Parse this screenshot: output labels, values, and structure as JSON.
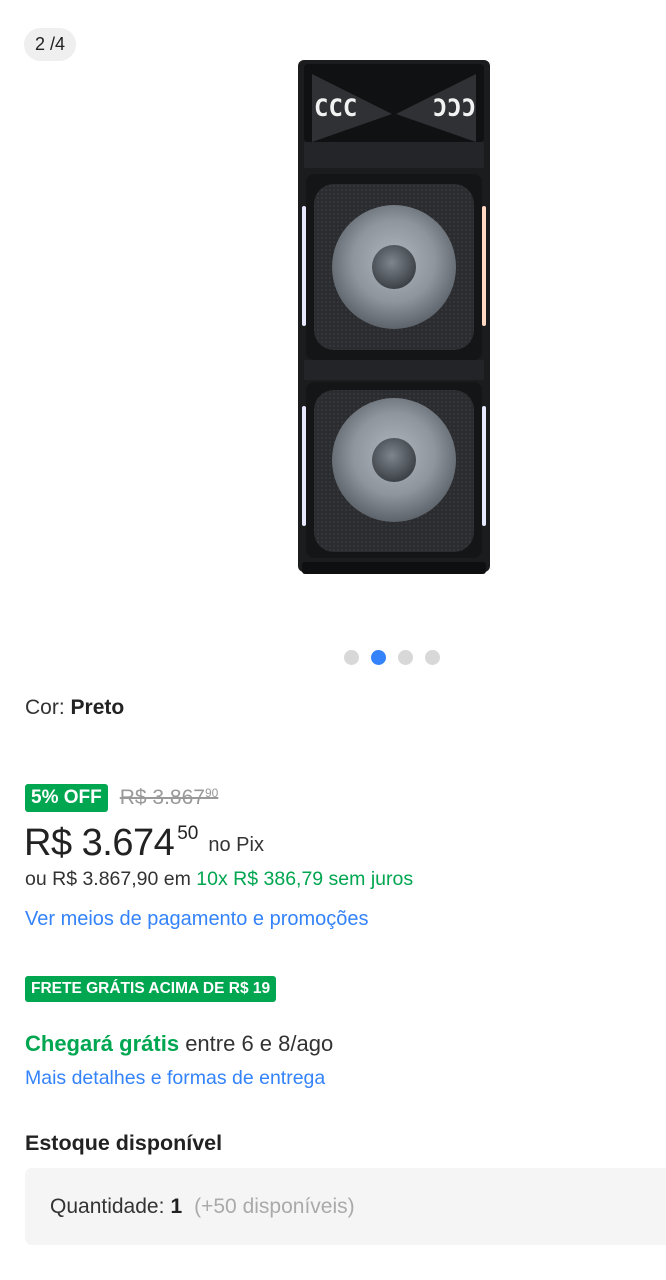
{
  "gallery": {
    "counter": "2 /4",
    "total_images": 4,
    "active_index": 1,
    "brand_mark_text": "CCC ƆƆƆ"
  },
  "product": {
    "color_label": "Cor:",
    "color_value": "Preto"
  },
  "pricing": {
    "discount_badge": "5% OFF",
    "old_price_int": "R$ 3.867",
    "old_price_cents": "90",
    "price_int": "R$ 3.674",
    "price_cents": "50",
    "price_method": "no Pix",
    "installments_prefix": "ou R$ 3.867,90 em",
    "installments_highlight": "10x R$ 386,79 sem juros",
    "payment_link": "Ver meios de pagamento e promoções"
  },
  "shipping": {
    "free_badge": "FRETE GRÁTIS ACIMA DE R$ 19",
    "arrival_highlight": "Chegará grátis",
    "arrival_rest": "entre 6 e 8/ago",
    "details_link": "Mais detalhes e formas de entrega"
  },
  "stock": {
    "title": "Estoque disponível",
    "qty_label": "Quantidade:",
    "qty_value": "1",
    "qty_available": "(+50 disponíveis)"
  },
  "colors": {
    "accent_blue": "#3483fa",
    "success_green": "#00a650"
  }
}
